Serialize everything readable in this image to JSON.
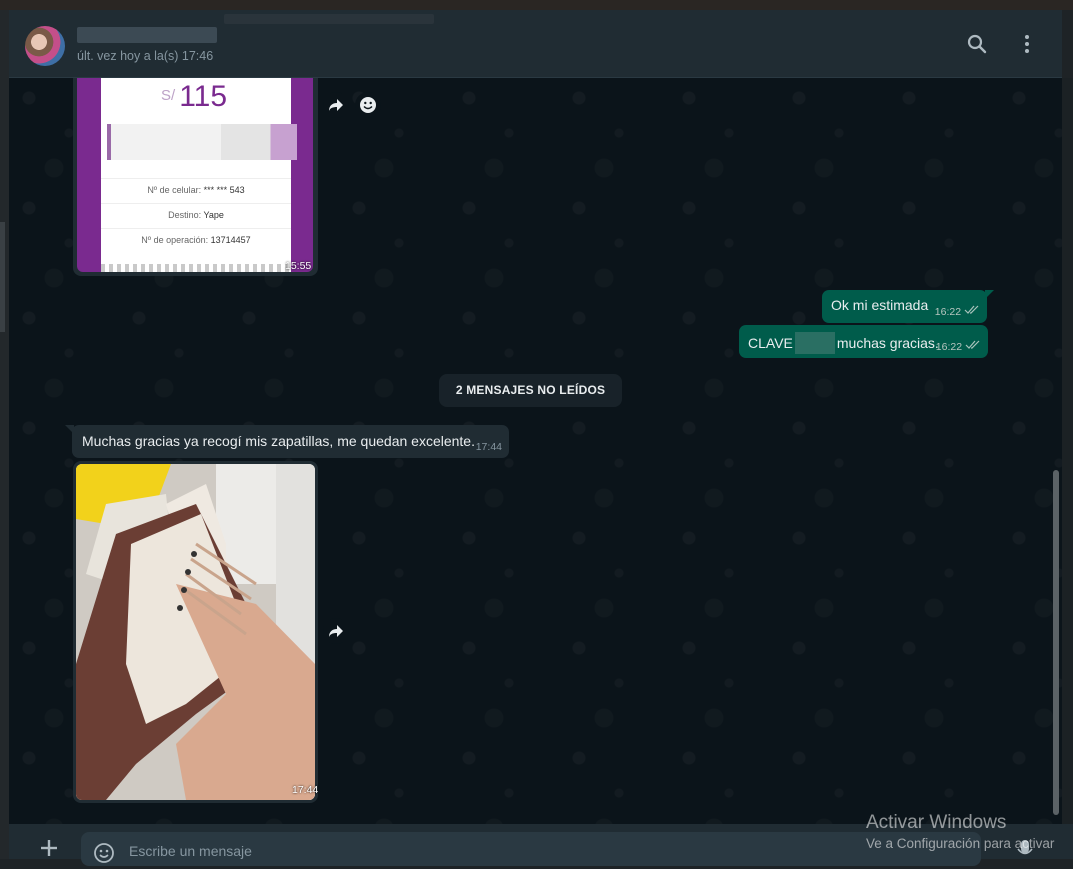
{
  "header": {
    "last_seen": "últ. vez hoy a la(s) 17:46",
    "icons": [
      "search-icon",
      "more-vertical-icon"
    ]
  },
  "messages": {
    "receipt": {
      "currency": "S/",
      "amount": "115",
      "phone_label": "Nº de celular:",
      "phone_value": "*** *** 543",
      "destino_label": "Destino:",
      "destino_value": "Yape",
      "operacion_label": "Nº de operación:",
      "operacion_value": "13714457",
      "time": "15:55"
    },
    "out1": {
      "text": "Ok mi estimada",
      "time": "16:22"
    },
    "out2": {
      "prefix": "CLAVE",
      "suffix": "muchas gracias.",
      "time": "16:22"
    },
    "unread_divider": "2 MENSAJES NO LEÍDOS",
    "in1": {
      "text": "Muchas gracias ya recogí mis zapatillas, me quedan excelente.",
      "time": "17:44"
    },
    "photo": {
      "time": "17:44"
    }
  },
  "composer": {
    "placeholder": "Escribe un mensaje"
  },
  "watermark": {
    "line1": "Activar Windows",
    "line2": "Ve a Configuración para activar"
  },
  "colors": {
    "outgoing": "#005c4b",
    "incoming": "#202c33",
    "background": "#0b141a",
    "yape": "#7a2a8f"
  }
}
